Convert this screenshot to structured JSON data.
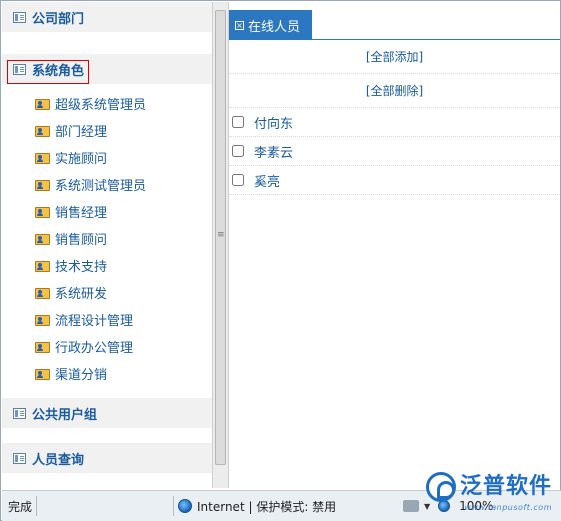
{
  "left_panel": {
    "sections": {
      "company_dept": "公司部门",
      "system_roles": "系统角色",
      "public_groups": "公共用户组",
      "user_query": "人员查询"
    },
    "roles": [
      "超级系统管理员",
      "部门经理",
      "实施顾问",
      "系统测试管理员",
      "销售经理",
      "销售顾问",
      "技术支持",
      "系统研发",
      "流程设计管理",
      "行政办公管理",
      "渠道分销"
    ]
  },
  "right_panel": {
    "tab_label": "在线人员",
    "add_all": "[全部添加]",
    "remove_all": "[全部删除]",
    "users": [
      {
        "name": "付向东",
        "checked": false
      },
      {
        "name": "李素云",
        "checked": false
      },
      {
        "name": "奚亮",
        "checked": false
      }
    ]
  },
  "status_bar": {
    "done": "完成",
    "zone": "Internet | 保护模式: 禁用",
    "zoom": "100%"
  },
  "watermark": {
    "brand": "泛普软件",
    "url": "www.fanpusoft.com"
  },
  "colors": {
    "link_blue": "#1a5b9e",
    "tab_blue": "#2b77c0",
    "selection_red": "#dd0000"
  }
}
